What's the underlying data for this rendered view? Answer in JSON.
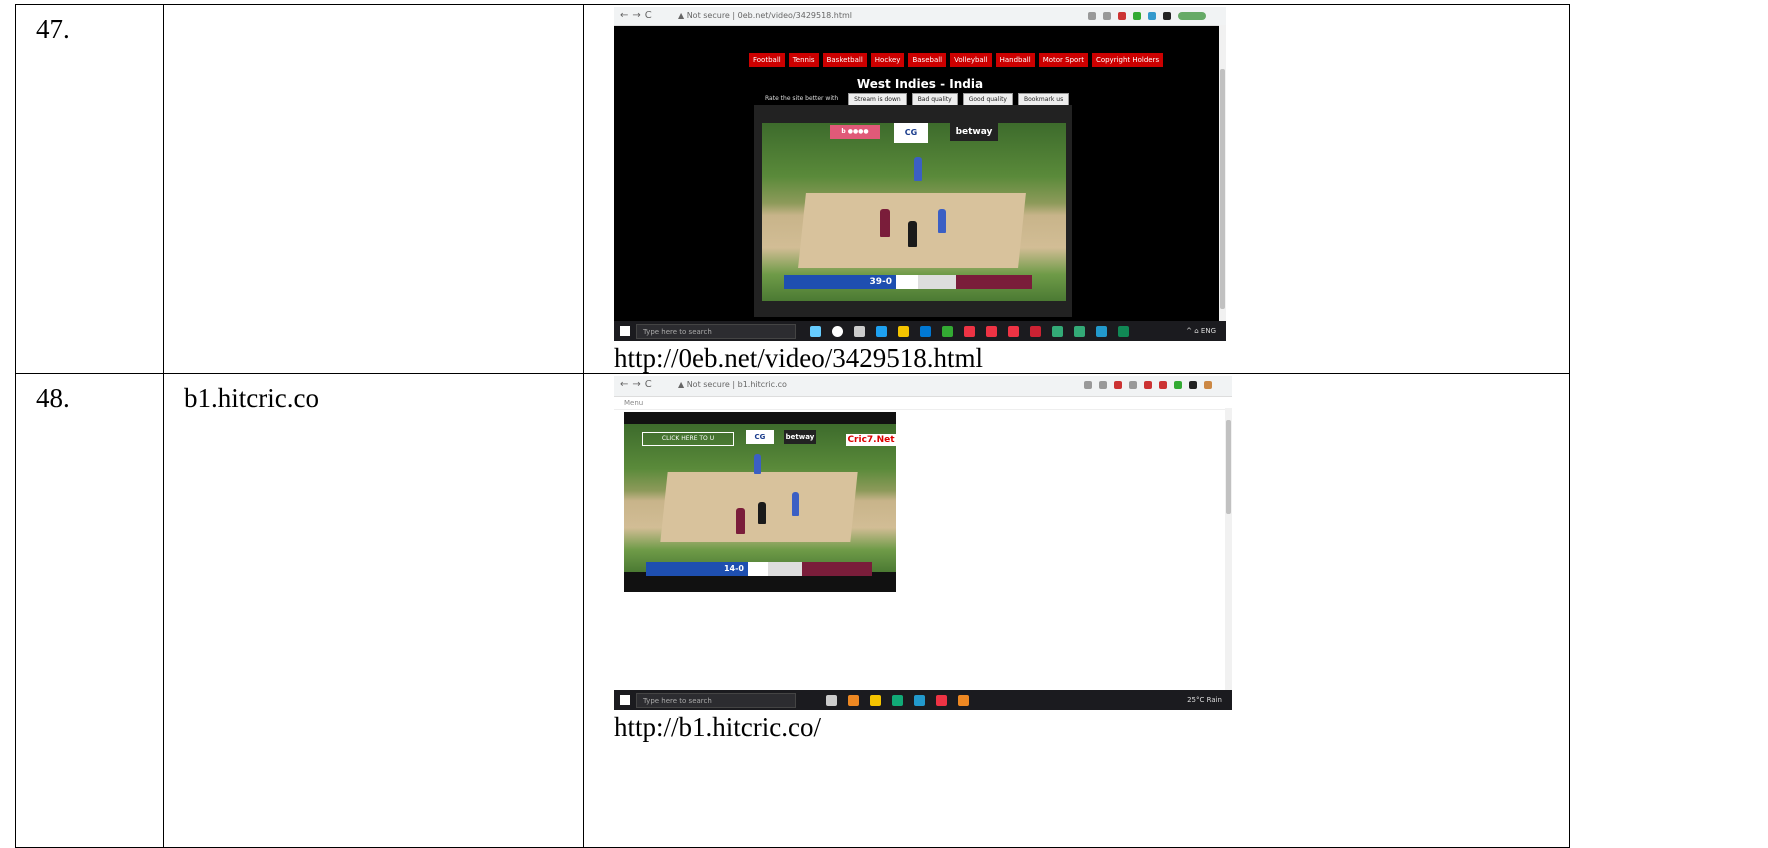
{
  "rows": [
    {
      "number": "47.",
      "site": "",
      "url": "http://0eb.net/video/3429518.html",
      "screenshot": {
        "menu": [
          "Football",
          "Tennis",
          "Basketball",
          "Hockey",
          "Baseball",
          "Volleyball",
          "Handball",
          "Motor Sport",
          "Copyright Holders"
        ],
        "video_title": "West Indies - India",
        "quality_label": "Rate the site better with",
        "quality_buttons": [
          "Stream is down",
          "Bad quality",
          "Good quality",
          "Bookmark us"
        ],
        "score_runs": "39-0",
        "ads": [
          "betway",
          "CG"
        ],
        "taskbar_search": "Type here to search"
      }
    },
    {
      "number": "48.",
      "site": "b1.hitcric.co",
      "url": "http://b1.hitcric.co/",
      "screenshot": {
        "overlay_button": "CLICK HERE TO U",
        "watermark": "Cric7.Net",
        "score_runs": "14-0",
        "ads": [
          "betway",
          "CG"
        ],
        "taskbar_search": "Type here to search",
        "weather": "25°C Rain"
      }
    }
  ],
  "colors": {
    "menu_red": "#cc0000",
    "score_blue": "#1e4fb0",
    "score_maroon": "#7a1d3a"
  }
}
